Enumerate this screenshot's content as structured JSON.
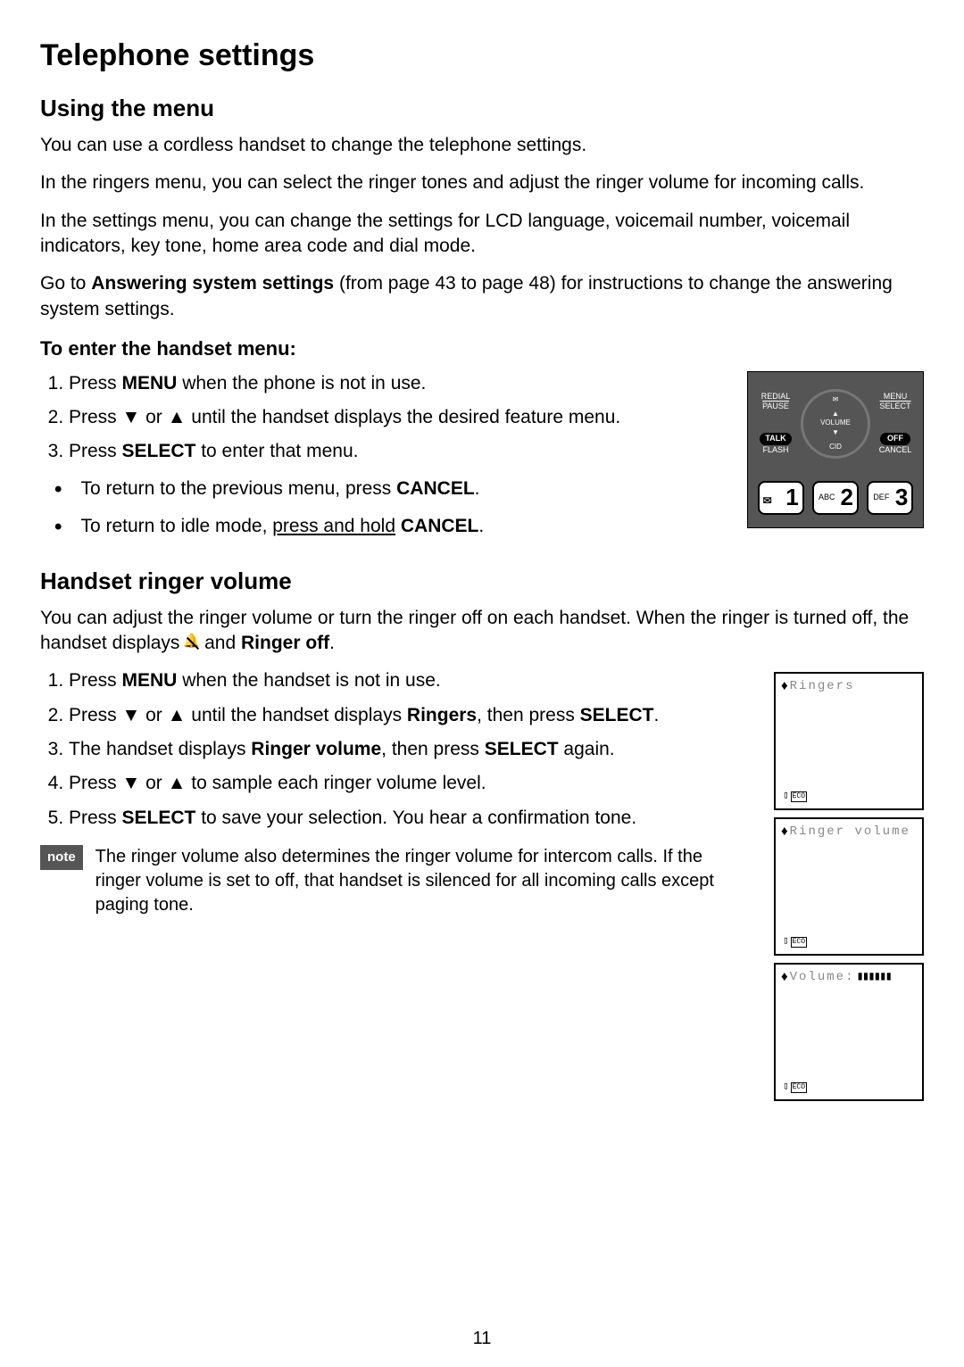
{
  "page_number": "11",
  "title": "Telephone settings",
  "section1": {
    "heading": "Using the menu",
    "p1": "You can use a cordless handset to change the telephone settings.",
    "p2": "In the ringers menu, you can select the ringer tones and adjust the ringer volume for incoming calls.",
    "p3": "In the settings menu, you can change the settings for LCD language, voicemail number, voicemail indicators, key tone, home area code and dial mode.",
    "p4a": "Go to ",
    "p4b": "Answering system settings",
    "p4c": " (from page 43 to page 48) for instructions to change the answering system settings.",
    "sub_heading": "To enter the handset menu:",
    "steps": [
      {
        "a": "Press ",
        "b": "MENU",
        "c": " when the phone is not in use."
      },
      {
        "a": "Press ▼ or ▲ until the handset displays the desired feature menu."
      },
      {
        "a": "Press ",
        "b": "SELECT",
        "c": " to enter that menu."
      }
    ],
    "bullets": [
      {
        "a": "To return to the previous menu, press ",
        "b": "CANCEL",
        "c": "."
      },
      {
        "a": "To return to idle mode, ",
        "u": "press and hold",
        "c": " ",
        "b": "CANCEL",
        "d": "."
      }
    ]
  },
  "phone": {
    "redial": "REDIAL",
    "pause": "PAUSE",
    "talk": "TALK",
    "flash": "FLASH",
    "menu": "MENU",
    "select": "SELECT",
    "off": "OFF",
    "cancel": "CANCEL",
    "volume": "VOLUME",
    "cid": "CID",
    "keys": [
      {
        "sub": "✉",
        "num": "1"
      },
      {
        "sub": "ABC",
        "num": "2"
      },
      {
        "sub": "DEF",
        "num": "3"
      }
    ]
  },
  "section2": {
    "heading": "Handset ringer volume",
    "intro_a": "You can adjust the ringer volume or turn the ringer off on each handset. When the ringer is turned off, the handset displays ",
    "intro_b": " and ",
    "intro_c": "Ringer off",
    "intro_d": ".",
    "steps": [
      {
        "a": "Press ",
        "b": "MENU",
        "c": " when the handset is not in use."
      },
      {
        "a": "Press ▼ or ▲ until the handset displays ",
        "b": "Ringers",
        "c": ", then press ",
        "b2": "SELECT",
        "d": "."
      },
      {
        "a": "The handset displays ",
        "b": "Ringer volume",
        "c": ", then press ",
        "b2": "SELECT",
        "d": " again."
      },
      {
        "a": "Press ▼ or ▲ to sample each ringer volume level."
      },
      {
        "a": "Press ",
        "b": "SELECT",
        "c": " to save your selection. You hear a confirmation tone."
      }
    ],
    "note_label": "note",
    "note_text": "The ringer volume also determines the ringer volume for intercom calls. If the ringer volume is set to off, that handset is silenced for all incoming calls except paging tone.",
    "lcds": [
      {
        "text": "Ringers",
        "eco": "ECO"
      },
      {
        "text": "Ringer volume",
        "eco": "ECO"
      },
      {
        "text": "Volume:",
        "bars": "▮▮▮▮▮▮",
        "eco": "ECO"
      }
    ]
  }
}
